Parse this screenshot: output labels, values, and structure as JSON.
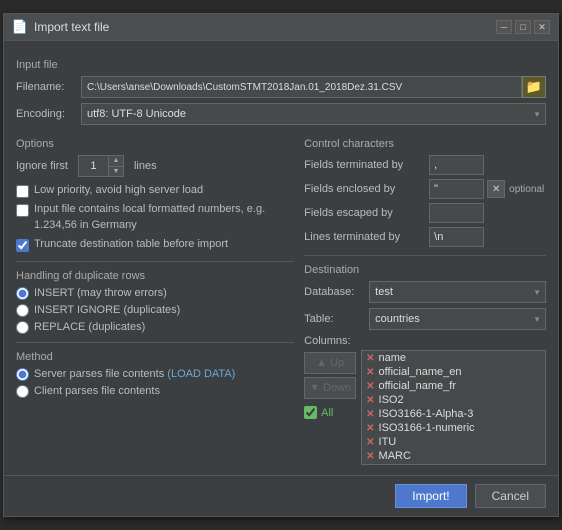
{
  "titleBar": {
    "icon": "📄",
    "title": "Import text file",
    "minBtn": "─",
    "maxBtn": "□",
    "closeBtn": "✕"
  },
  "inputFile": {
    "sectionLabel": "Input file",
    "filenameLabel": "Filename:",
    "filenameValue": "C:\\Users\\anse\\Downloads\\CustomSTMT2018Jan.01_2018Dez.31.CSV",
    "encodingLabel": "Encoding:",
    "encodingValue": "utf8: UTF-8 Unicode"
  },
  "options": {
    "sectionLabel": "Options",
    "ignoreFirst": "Ignore first",
    "ignoreValue": "1",
    "lines": "lines",
    "checkboxes": [
      {
        "id": "low-priority",
        "checked": false,
        "label": "Low priority, avoid high server load"
      },
      {
        "id": "local-formatted",
        "checked": false,
        "label": "Input file contains local formatted numbers, e.g. 1.234,56 in Germany"
      },
      {
        "id": "truncate",
        "checked": true,
        "label": "Truncate destination table before import"
      }
    ]
  },
  "duplicateRows": {
    "sectionLabel": "Handling of duplicate rows",
    "radios": [
      {
        "id": "insert-errors",
        "checked": true,
        "label": "INSERT (may throw errors)"
      },
      {
        "id": "insert-ignore",
        "checked": false,
        "label": "INSERT IGNORE (duplicates)"
      },
      {
        "id": "replace",
        "checked": false,
        "label": "REPLACE (duplicates)"
      }
    ]
  },
  "method": {
    "sectionLabel": "Method",
    "radios": [
      {
        "id": "server-parses",
        "checked": true,
        "label": "Server parses file contents (LOAD DATA)"
      },
      {
        "id": "client-parses",
        "checked": false,
        "label": "Client parses file contents"
      }
    ]
  },
  "controlCharacters": {
    "sectionLabel": "Control characters",
    "rows": [
      {
        "label": "Fields terminated by",
        "value": ","
      },
      {
        "label": "Fields enclosed by",
        "value": "\"",
        "hasX": true,
        "optional": "optional"
      },
      {
        "label": "Fields escaped by",
        "value": ""
      },
      {
        "label": "Lines terminated by",
        "value": "\\n"
      }
    ]
  },
  "destination": {
    "sectionLabel": "Destination",
    "databaseLabel": "Database:",
    "databaseValue": "test",
    "tableLabel": "Table:",
    "tableValue": "countries",
    "columnsLabel": "Columns:",
    "upBtn": "▲ Up",
    "downBtn": "▼ Down",
    "allLabel": "All",
    "columns": [
      {
        "name": "name"
      },
      {
        "name": "official_name_en"
      },
      {
        "name": "official_name_fr"
      },
      {
        "name": "ISO2"
      },
      {
        "name": "ISO3166-1-Alpha-3"
      },
      {
        "name": "ISO3166-1-numeric"
      },
      {
        "name": "ITU"
      },
      {
        "name": "MARC"
      }
    ]
  },
  "footer": {
    "importBtn": "Import!",
    "cancelBtn": "Cancel"
  }
}
